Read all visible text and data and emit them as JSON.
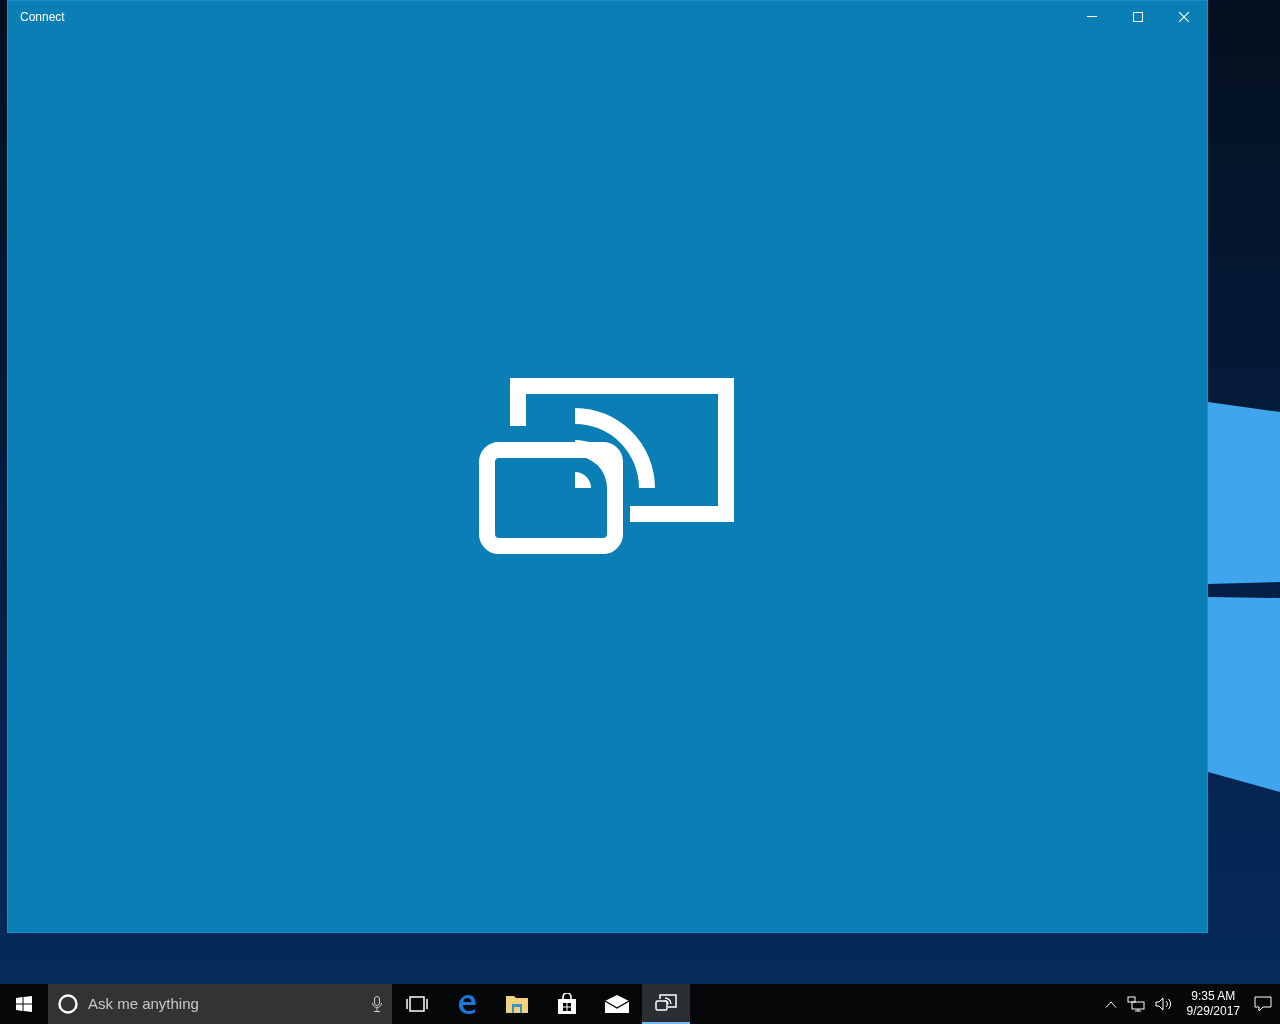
{
  "window": {
    "title": "Connect"
  },
  "taskbar": {
    "search": {
      "placeholder": "Ask me anything"
    },
    "apps": [
      {
        "kind": "taskview",
        "selected": false
      },
      {
        "kind": "edge",
        "selected": false
      },
      {
        "kind": "explorer",
        "selected": false
      },
      {
        "kind": "store",
        "selected": false
      },
      {
        "kind": "mail",
        "selected": false
      },
      {
        "kind": "connect",
        "selected": true
      }
    ],
    "clock": {
      "time": "9:35 AM",
      "date": "9/29/2017"
    }
  }
}
